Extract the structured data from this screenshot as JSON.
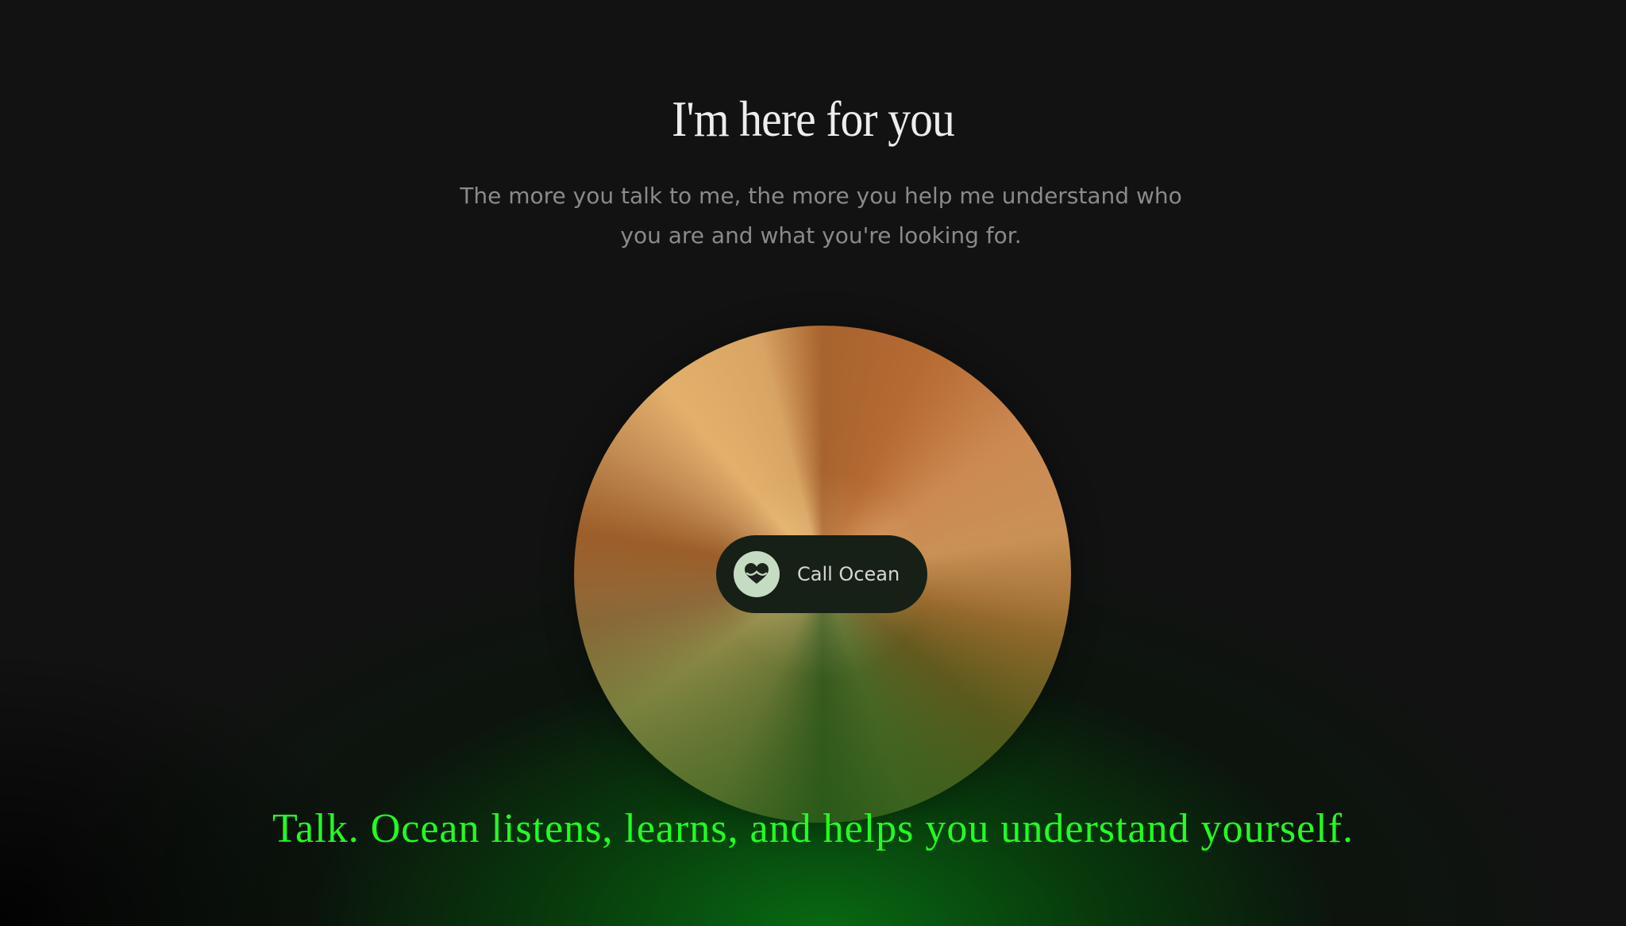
{
  "hero": {
    "title": "I'm here for you",
    "subtitle": "The more you talk to me, the more you help me understand who you are and what you're looking for."
  },
  "call": {
    "label": "Call Ocean",
    "icon": "ocean-heart-icon"
  },
  "tagline": "Talk. Ocean listens, learns, and helps you understand yourself.",
  "colors": {
    "background": "#121212",
    "title": "#ededed",
    "subtitle": "#8a8a8a",
    "button_bg": "#162016",
    "icon_bg": "#c5dcc3",
    "tagline": "#22ff22",
    "glow": "#086e12"
  }
}
